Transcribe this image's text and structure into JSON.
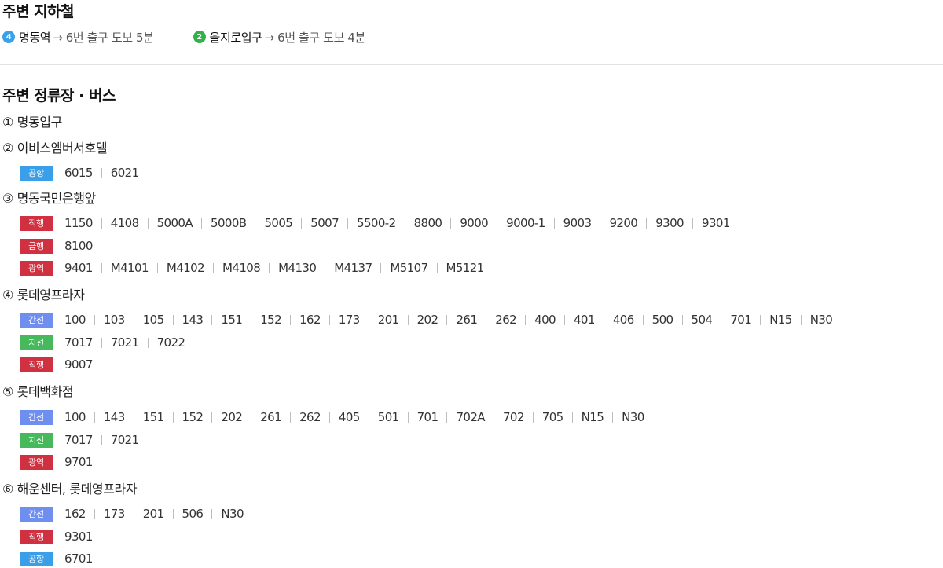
{
  "subway": {
    "title": "주변 지하철",
    "stations": [
      {
        "line": "4",
        "color": "#3aa0e8",
        "name": "명동역",
        "route": "→ 6번 출구 도보 5분"
      },
      {
        "line": "2",
        "color": "#33b04a",
        "name": "을지로입구",
        "route": "→ 6번 출구 도보 4분"
      }
    ]
  },
  "bus": {
    "title": "주변 정류장 · 버스",
    "stops": [
      {
        "name": "① 명동입구",
        "routes": []
      },
      {
        "name": "② 이비스엠버서호텔",
        "routes": [
          {
            "type": "공항",
            "color": "#3a9ee8",
            "numbers": [
              "6015",
              "6021"
            ]
          }
        ]
      },
      {
        "name": "③ 명동국민은행앞",
        "routes": [
          {
            "type": "직행",
            "color": "#d03140",
            "numbers": [
              "1150",
              "4108",
              "5000A",
              "5000B",
              "5005",
              "5007",
              "5500-2",
              "8800",
              "9000",
              "9000-1",
              "9003",
              "9200",
              "9300",
              "9301"
            ]
          },
          {
            "type": "급행",
            "color": "#d03140",
            "numbers": [
              "8100"
            ]
          },
          {
            "type": "광역",
            "color": "#d03140",
            "numbers": [
              "9401",
              "M4101",
              "M4102",
              "M4108",
              "M4130",
              "M4137",
              "M5107",
              "M5121"
            ]
          }
        ]
      },
      {
        "name": "④ 롯데영프라자",
        "routes": [
          {
            "type": "간선",
            "color": "#6e8ff0",
            "numbers": [
              "100",
              "103",
              "105",
              "143",
              "151",
              "152",
              "162",
              "173",
              "201",
              "202",
              "261",
              "262",
              "400",
              "401",
              "406",
              "500",
              "504",
              "701",
              "N15",
              "N30"
            ]
          },
          {
            "type": "지선",
            "color": "#47b85c",
            "numbers": [
              "7017",
              "7021",
              "7022"
            ]
          },
          {
            "type": "직행",
            "color": "#d03140",
            "numbers": [
              "9007"
            ]
          }
        ]
      },
      {
        "name": "⑤ 롯데백화점",
        "routes": [
          {
            "type": "간선",
            "color": "#6e8ff0",
            "numbers": [
              "100",
              "143",
              "151",
              "152",
              "202",
              "261",
              "262",
              "405",
              "501",
              "701",
              "702A",
              "702",
              "705",
              "N15",
              "N30"
            ]
          },
          {
            "type": "지선",
            "color": "#47b85c",
            "numbers": [
              "7017",
              "7021"
            ]
          },
          {
            "type": "광역",
            "color": "#d03140",
            "numbers": [
              "9701"
            ]
          }
        ]
      },
      {
        "name": "⑥ 해운센터, 롯데영프라자",
        "routes": [
          {
            "type": "간선",
            "color": "#6e8ff0",
            "numbers": [
              "162",
              "173",
              "201",
              "506",
              "N30"
            ]
          },
          {
            "type": "직행",
            "color": "#d03140",
            "numbers": [
              "9301"
            ]
          },
          {
            "type": "공항",
            "color": "#3a9ee8",
            "numbers": [
              "6701"
            ]
          }
        ]
      }
    ]
  }
}
